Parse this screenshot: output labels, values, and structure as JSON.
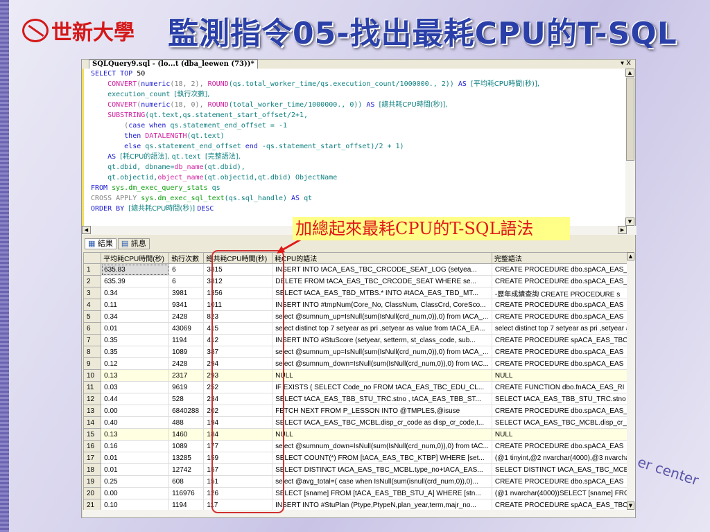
{
  "slide": {
    "logo_text": "世新大學",
    "title": "監測指令05-找出最耗CPU的T-SQL",
    "callout": "加總起來最耗CPU的T-SQL語法",
    "watermark": "er center"
  },
  "window": {
    "doc_tab": "SQLQuery9.sql - (lo...t (dba_leewen (73))*",
    "controls": "▾ X"
  },
  "code": [
    [
      [
        "SELECT TOP ",
        "kw"
      ],
      [
        "50",
        "bl"
      ]
    ],
    [
      [
        "    CONVERT",
        "fn"
      ],
      [
        "(",
        "gr"
      ],
      [
        "numeric",
        "kw"
      ],
      [
        "(18, 2), ",
        "gr"
      ],
      [
        "ROUND",
        "fn"
      ],
      [
        "(qs.total_worker_time/qs.execution_count/1000000., 2)) ",
        "tx"
      ],
      [
        "AS ",
        "kw"
      ],
      [
        "[平均耗CPU時間(秒)],",
        "cn"
      ]
    ],
    [
      [
        "    execution_count ",
        "tx"
      ],
      [
        "[執行次數],",
        "cn"
      ]
    ],
    [
      [
        "    CONVERT",
        "fn"
      ],
      [
        "(",
        "gr"
      ],
      [
        "numeric",
        "kw"
      ],
      [
        "(18, 0), ",
        "gr"
      ],
      [
        "ROUND",
        "fn"
      ],
      [
        "(total_worker_time/1000000., 0)) ",
        "tx"
      ],
      [
        "AS ",
        "kw"
      ],
      [
        "[總共耗CPU時間(秒)],",
        "cn"
      ]
    ],
    [
      [
        "    SUBSTRING",
        "fn"
      ],
      [
        "(qt.text,qs.statement_start_offset/2+1,",
        "tx"
      ]
    ],
    [
      [
        "        (",
        "gr"
      ],
      [
        "case when ",
        "kw"
      ],
      [
        "qs.statement_end_offset = -1",
        "tx"
      ]
    ],
    [
      [
        "        then ",
        "kw"
      ],
      [
        "DATALENGTH",
        "fn"
      ],
      [
        "(qt.text)",
        "tx"
      ]
    ],
    [
      [
        "        else ",
        "kw"
      ],
      [
        "qs.statement_end_offset ",
        "tx"
      ],
      [
        "end ",
        "kw"
      ],
      [
        "-qs.statement_start_offset)/2 + 1)",
        "tx"
      ]
    ],
    [
      [
        "    AS ",
        "kw"
      ],
      [
        "[耗CPU的語法], ",
        "cn"
      ],
      [
        "qt.text ",
        "tx"
      ],
      [
        "[完整語法],",
        "cn"
      ]
    ],
    [
      [
        "    qt.dbid, dbname=",
        "tx"
      ],
      [
        "db_name",
        "fn"
      ],
      [
        "(qt.dbid),",
        "tx"
      ]
    ],
    [
      [
        "    qt.objectid,",
        "tx"
      ],
      [
        "object_name",
        "fn"
      ],
      [
        "(qt.objectid,qt.dbid) ObjectName",
        "tx"
      ]
    ],
    [
      [
        "FROM ",
        "kw"
      ],
      [
        "sys.dm_exec_query_stats ",
        "sys"
      ],
      [
        "qs",
        "tx"
      ]
    ],
    [
      [
        "CROSS APPLY ",
        "gr"
      ],
      [
        "sys.dm_exec_sql_text",
        "sys"
      ],
      [
        "(qs.sql_handle) ",
        "tx"
      ],
      [
        "AS ",
        "kw"
      ],
      [
        "qt",
        "tx"
      ]
    ],
    [
      [
        "ORDER BY ",
        "kw"
      ],
      [
        "[總共耗CPU時間(秒)] ",
        "cn"
      ],
      [
        "DESC",
        "kw"
      ]
    ]
  ],
  "results": {
    "tabs": [
      "結果",
      "訊息"
    ],
    "columns": [
      "",
      "平均耗CPU時間(秒)",
      "執行次數",
      "總共耗CPU時間(秒)",
      "耗CPU的語法",
      "完整語法"
    ],
    "rows": [
      [
        "1",
        "635.83",
        "6",
        "3815",
        "INSERT  INTO  tACA_EAS_TBC_CRCODE_SEAT_LOG  (setyea...",
        "CREATE PROCEDURE dbo.spACA_EAS_"
      ],
      [
        "2",
        "635.39",
        "6",
        "3812",
        "DELETE FROM tACA_EAS_TBC_CRCODE_SEAT    WHERE se...",
        "CREATE PROCEDURE dbo.spACA_EAS_"
      ],
      [
        "3",
        "0.34",
        "3981",
        "1356",
        "SELECT tACA_EAS_TBD_MTBS.* INTO #tACA_EAS_TBD_MT...",
        "-歷年成績查詢  CREATE PROCEDURE s"
      ],
      [
        "4",
        "0.11",
        "9341",
        "1011",
        "INSERT INTO #tmpNum(Core_No, ClassNum, ClassCrd, CoreSco...",
        "CREATE PROCEDURE dbo.spACA_EAS"
      ],
      [
        "5",
        "0.34",
        "2428",
        "823",
        "select @sumnum_up=IsNull(sum(IsNull(crd_num,0)),0) from tACA_...",
        "CREATE PROCEDURE dbo.spACA_EAS"
      ],
      [
        "6",
        "0.01",
        "43069",
        "415",
        "select distinct top 7 setyear as pri ,setyear as value from tACA_EA...",
        "select distinct top 7 setyear as pri ,setyear a"
      ],
      [
        "7",
        "0.35",
        "1194",
        "412",
        "INSERT INTO #StuScore    (setyear, setterm, st_class_code, sub...",
        "CREATE PROCEDURE spACA_EAS_TBC_"
      ],
      [
        "8",
        "0.35",
        "1089",
        "387",
        "select @sumnum_up=IsNull(sum(IsNull(crd_num,0)),0) from tACA_...",
        "CREATE  PROCEDURE dbo.spACA_EAS"
      ],
      [
        "9",
        "0.12",
        "2428",
        "294",
        "select @sumnum_down=IsNull(sum(IsNull(crd_num,0)),0) from tAC...",
        "CREATE PROCEDURE dbo.spACA_EAS"
      ],
      [
        "10",
        "0.13",
        "2317",
        "293",
        "NULL",
        "NULL"
      ],
      [
        "11",
        "0.03",
        "9619",
        "252",
        "IF EXISTS ( SELECT Code_no FROM tACA_EAS_TBC_EDU_CL...",
        "CREATE FUNCTION dbo.fnACA_EAS_RI"
      ],
      [
        "12",
        "0.44",
        "528",
        "234",
        "SELECT tACA_EAS_TBB_STU_TRC.stno , tACA_EAS_TBB_ST...",
        "SELECT tACA_EAS_TBB_STU_TRC.stno"
      ],
      [
        "13",
        "0.00",
        "6840288",
        "202",
        "FETCH NEXT FROM P_LESSON INTO @TMPLES,@isuse",
        "CREATE PROCEDURE dbo.spACA_EAS_"
      ],
      [
        "14",
        "0.40",
        "488",
        "194",
        "SELECT tACA_EAS_TBC_MCBL.disp_cr_code as disp_cr_code,t...",
        "SELECT tACA_EAS_TBC_MCBL.disp_cr_c"
      ],
      [
        "15",
        "0.13",
        "1460",
        "184",
        "NULL",
        "NULL"
      ],
      [
        "16",
        "0.16",
        "1089",
        "177",
        "select @sumnum_down=IsNull(sum(IsNull(crd_num,0)),0) from tAC...",
        "CREATE  PROCEDURE dbo.spACA_EAS"
      ],
      [
        "17",
        "0.01",
        "13285",
        "159",
        "SELECT COUNT(*) FROM [tACA_EAS_TBC_KTBP] WHERE [set...",
        "(@1 tinyint,@2 nvarchar(4000),@3 nvarcha"
      ],
      [
        "18",
        "0.01",
        "12742",
        "157",
        "SELECT DISTINCT tACA_EAS_TBC_MCBL.type_no+tACA_EAS...",
        "SELECT DISTINCT tACA_EAS_TBC_MCB"
      ],
      [
        "19",
        "0.25",
        "608",
        "151",
        "select @avg_total=(    case when IsNull(sum(isnull(crd_num,0)),0)...",
        "CREATE PROCEDURE dbo.spACA_EAS"
      ],
      [
        "20",
        "0.00",
        "116976",
        "126",
        "SELECT [sname] FROM [tACA_EAS_TBB_STU_A] WHERE [stn...",
        "(@1 nvarchar(4000))SELECT [sname] FRO"
      ],
      [
        "21",
        "0.10",
        "1194",
        "117",
        "INSERT INTO #StuPlan    (Ptype,PtypeN,plan_year,term,majr_no...",
        "CREATE PROCEDURE spACA_EAS_TBC_"
      ]
    ]
  },
  "colors": {
    "accent": "#2a3fa8",
    "highlight": "#d03030",
    "callout_bg": "#ffff88"
  }
}
